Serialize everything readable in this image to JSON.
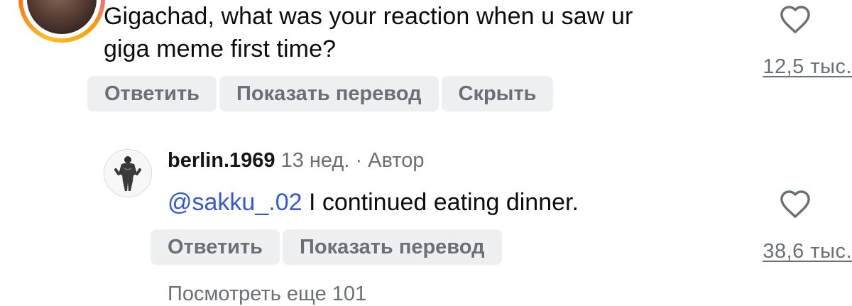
{
  "top_comment": {
    "line1": "Gigachad, what was your reaction when u saw ur",
    "line2": "giga meme first time?",
    "likes": "12,5 тыс.",
    "actions": {
      "reply": "Ответить",
      "translate": "Показать перевод",
      "hide": "Скрыть"
    }
  },
  "reply": {
    "username": "berlin.1969",
    "meta": " 13 нед. · Автор",
    "mention": "@sakku_.02",
    "text": " I continued eating dinner.",
    "likes": "38,6 тыс.",
    "actions": {
      "reply": "Ответить",
      "translate": "Показать перевод"
    }
  },
  "more_replies_partial": "Посмотреть еще 101",
  "icons": {
    "like": "heart-icon",
    "avatar_border_gradient": [
      "#fbbf24",
      "#f97316",
      "#e11d48",
      "#d946ef"
    ]
  },
  "colors": {
    "mention": "#3458d6",
    "muted": "#6b6f76",
    "chip_bg": "#eeeff1"
  }
}
